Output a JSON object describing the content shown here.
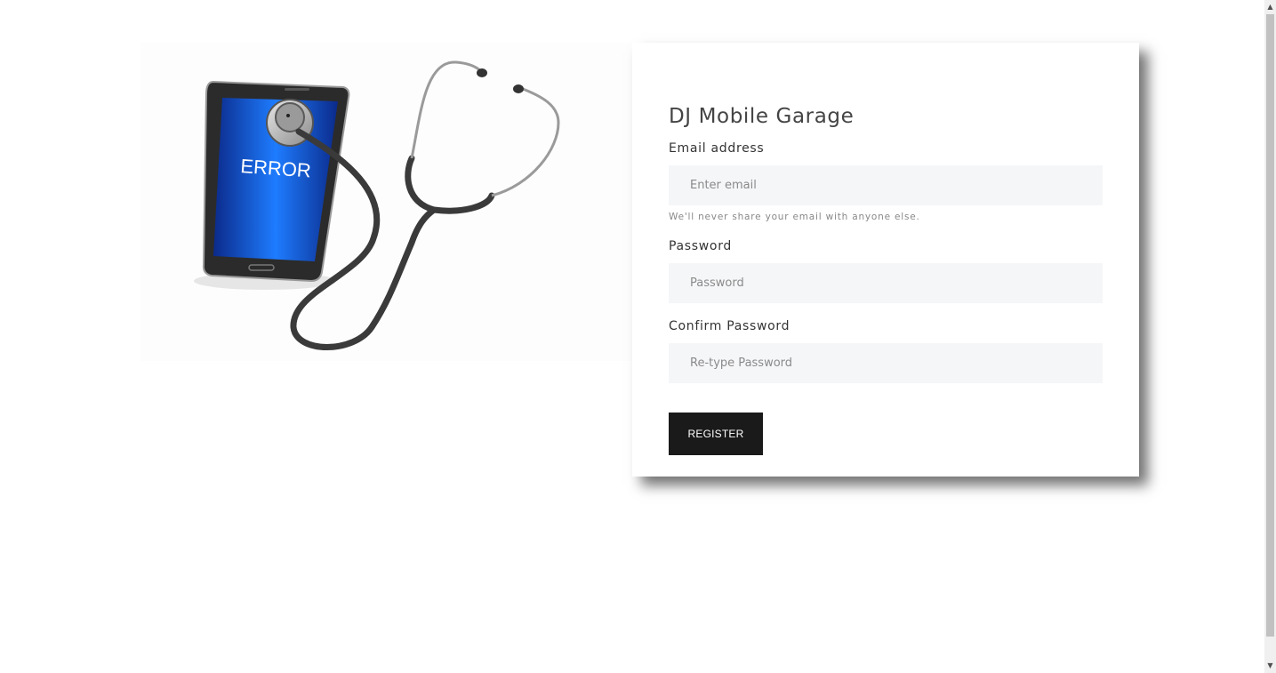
{
  "hero": {
    "screen_text": "ERROR",
    "icon": "phone-stethoscope-illustration"
  },
  "form": {
    "title": "DJ Mobile Garage",
    "email": {
      "label": "Email address",
      "placeholder": "Enter email",
      "value": "",
      "help": "We'll never share your email with anyone else."
    },
    "password": {
      "label": "Password",
      "placeholder": "Password",
      "value": ""
    },
    "confirm": {
      "label": "Confirm Password",
      "placeholder": "Re-type Password",
      "value": ""
    },
    "submit_label": "REGISTER"
  },
  "scrollbar": {
    "up_icon": "▲",
    "down_icon": "▼"
  },
  "colors": {
    "button_bg": "#1b1a1a",
    "field_bg": "#f5f6f8",
    "screen_blue": "#0a5fe0"
  }
}
